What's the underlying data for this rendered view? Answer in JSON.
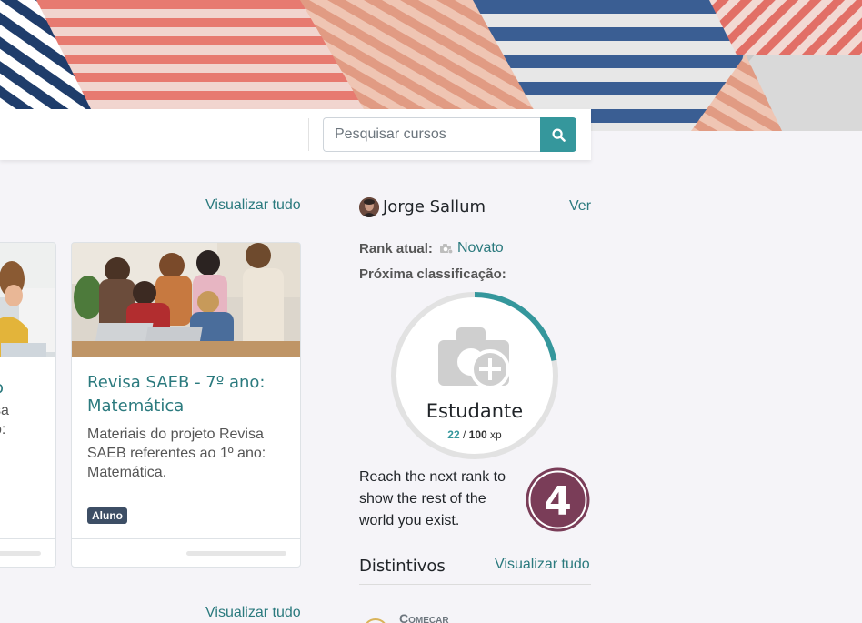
{
  "search": {
    "placeholder": "Pesquisar cursos"
  },
  "courses": {
    "view_all_label": "Visualizar tudo",
    "left_card_fragment": {
      "title": "o",
      "line1": "sa",
      "line2": "o:"
    },
    "featured_card": {
      "title": "Revisa SAEB - 7º ano: Matemática",
      "description": "Materiais do projeto Revisa SAEB referentes ao 1º ano: Matemática.",
      "badge": "Aluno"
    },
    "bottom_view_all_label": "Visualizar tudo"
  },
  "profile": {
    "name": "Jorge Sallum",
    "view_label": "Ver",
    "rank_label": "Rank atual:",
    "rank_value": "Novato",
    "next_rank_label": "Próxima classificação:",
    "next_rank_name": "Estudante",
    "xp_current": "22",
    "xp_separator": "/",
    "xp_max": "100",
    "xp_unit": "xp",
    "progress_fraction": 0.22,
    "motivation": "Reach the next rank to show the rest of the world you exist.",
    "rank_badge_number": "4"
  },
  "badges": {
    "title": "Distintivos",
    "view_all_label": "Visualizar tudo",
    "first_item": "Começar"
  },
  "colors": {
    "accent": "#35979c",
    "link": "#2b7a7e",
    "rank_badge": "#7a3d58",
    "badge_bg": "#3d4e65"
  }
}
